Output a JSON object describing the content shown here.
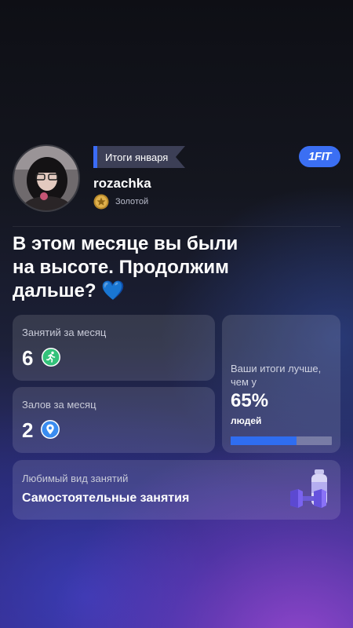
{
  "header": {
    "banner": "Итоги января",
    "brand": "1FIT"
  },
  "profile": {
    "username": "rozachka",
    "tier": "Золотой"
  },
  "headline": "В этом месяце вы были\nна высоте. Продолжим\nдальше? 💙",
  "stats": {
    "sessions": {
      "label": "Занятий за месяц",
      "value": "6",
      "icon": "running-person-icon"
    },
    "gyms": {
      "label": "Залов за месяц",
      "value": "2",
      "icon": "location-pin-icon"
    },
    "comparison": {
      "text": "Ваши итоги лучше, чем у",
      "value": "65%",
      "unit": "людей",
      "progress": 0.65
    },
    "favorite": {
      "label": "Любимый вид занятий",
      "value": "Самостоятельные занятия",
      "icon": "dumbbell-bottle-icon"
    }
  },
  "colors": {
    "accent": "#3b6ff3",
    "progress_fill": "#2f6df0",
    "sessions_icon": "#33c27a",
    "gyms_icon": "#3a8cf0"
  }
}
